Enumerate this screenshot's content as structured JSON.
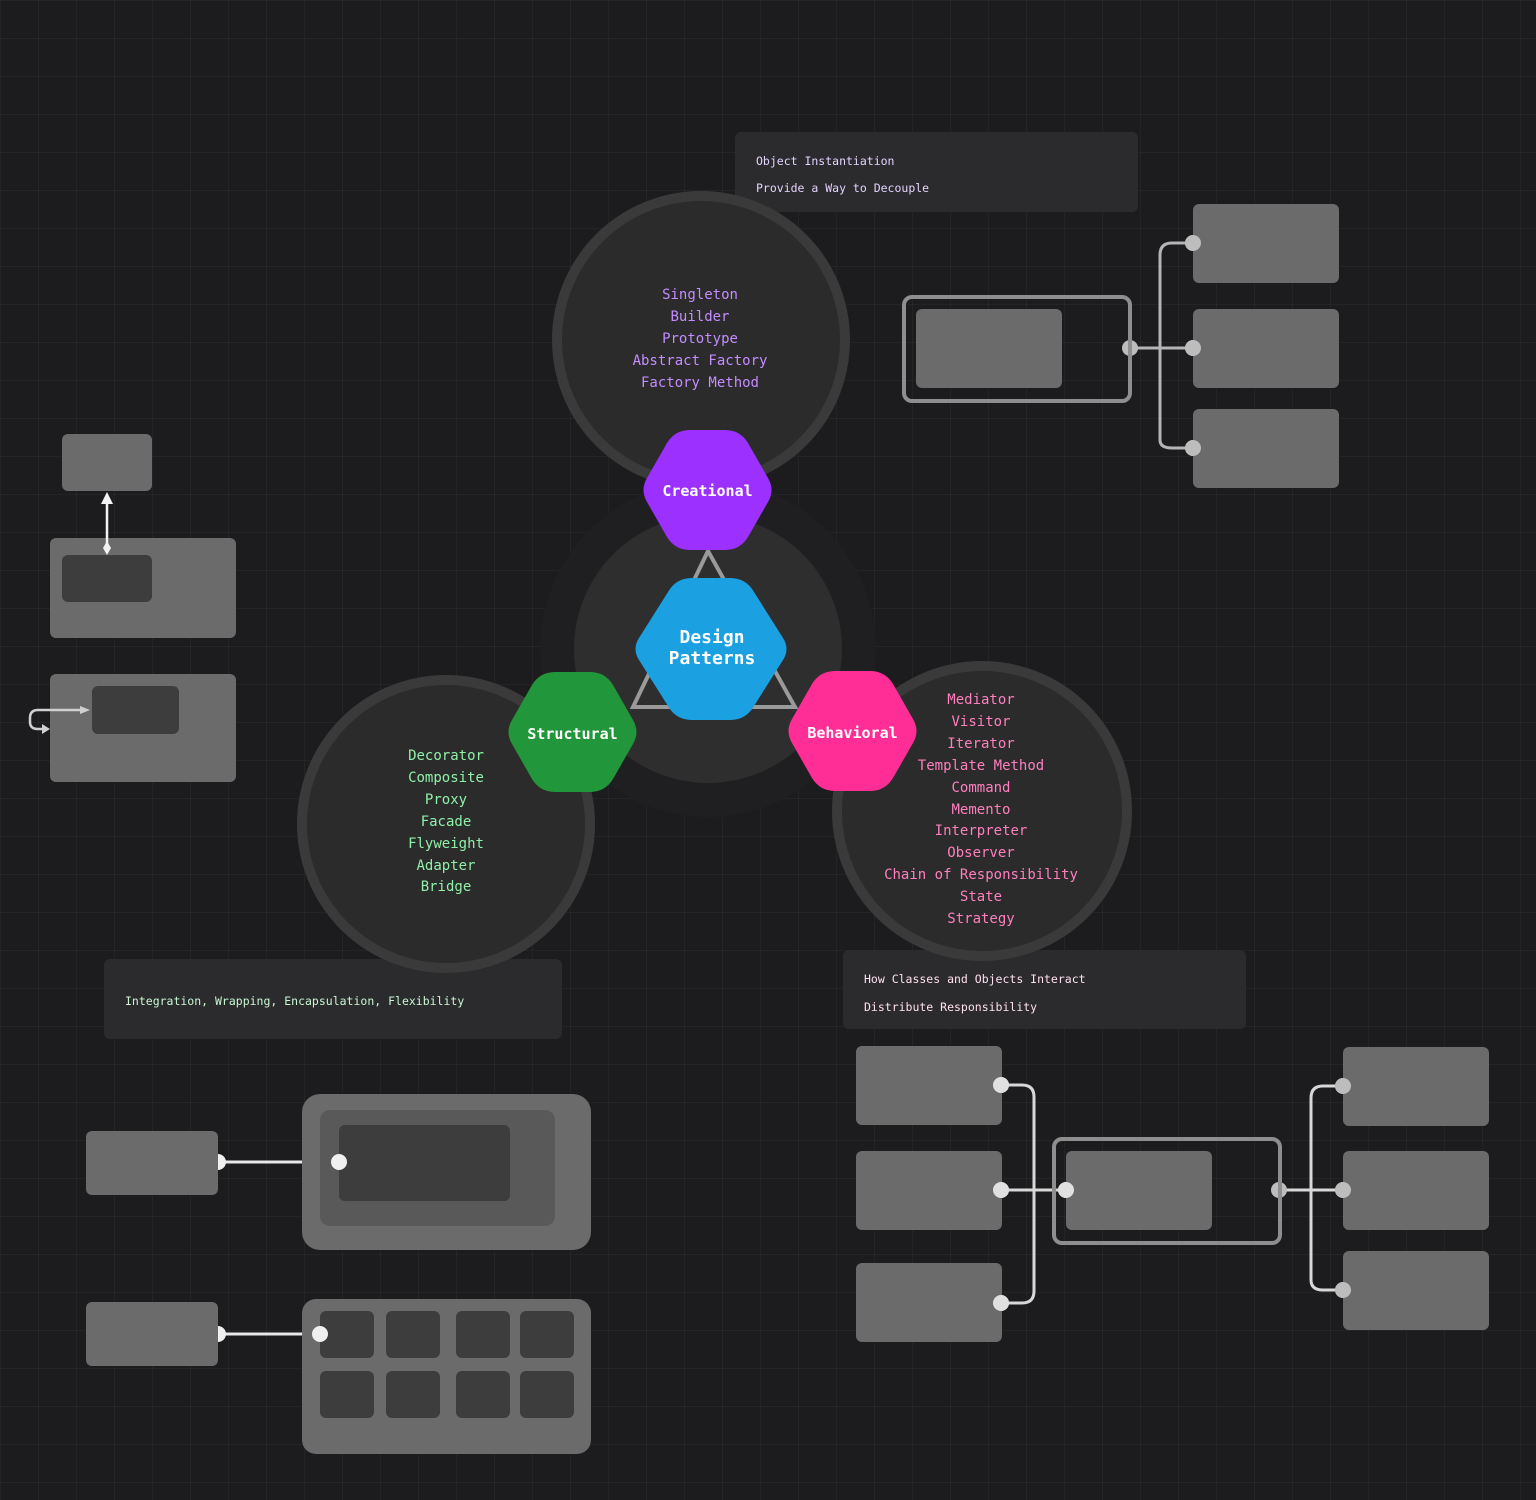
{
  "center": {
    "title": "Design Patterns",
    "color": "#1ba1e2"
  },
  "creational": {
    "label": "Creational",
    "color": "#9b30ff",
    "text_color": "#c58cff",
    "patterns": [
      "Singleton",
      "Builder",
      "Prototype",
      "Abstract Factory",
      "Factory Method"
    ],
    "notes": [
      "Object Instantiation",
      "Provide a Way to Decouple"
    ]
  },
  "structural": {
    "label": "Structural",
    "color": "#22963a",
    "text_color": "#8ff0a8",
    "patterns": [
      "Decorator",
      "Composite",
      "Proxy",
      "Facade",
      "Flyweight",
      "Adapter",
      "Bridge"
    ],
    "notes": [
      "Integration, Wrapping, Encapsulation, Flexibility"
    ]
  },
  "behavioral": {
    "label": "Behavioral",
    "color": "#ff2e97",
    "text_color": "#ff7fbf",
    "patterns": [
      "Mediator",
      "Visitor",
      "Iterator",
      "Template Method",
      "Command",
      "Memento",
      "Interpreter",
      "Observer",
      "Chain of Responsibility",
      "State",
      "Strategy"
    ],
    "notes": [
      "How Classes and Objects Interact",
      "Distribute Responsibility"
    ]
  },
  "palette": {
    "background": "#1c1c1e",
    "placeholder_box": "#6b6b6b",
    "inner_box": "#3d3d3d",
    "connector": "#c8c8c8"
  }
}
